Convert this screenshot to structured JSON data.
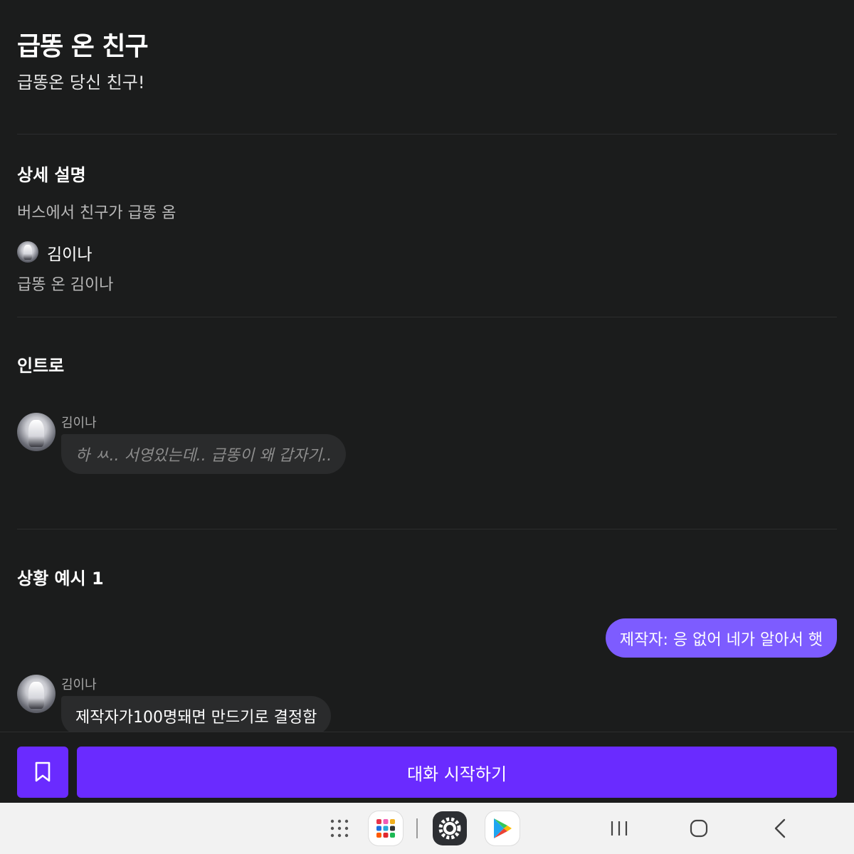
{
  "header": {
    "title": "급똥 온 친구",
    "subtitle": "급똥온 당신 친구!"
  },
  "detail": {
    "heading": "상세 설명",
    "description": "버스에서 친구가 급똥 옴",
    "creator_name": "김이나",
    "creator_line": "급똥 온 김이나"
  },
  "intro": {
    "heading": "인트로",
    "speaker": "김이나",
    "message": "하 ㅆ.. 서영있는데.. 급똥이 왜 갑자기.."
  },
  "example": {
    "heading": "상황 예시 1",
    "user_message": "제작자: 응 없어 네가 알아서 햇",
    "speaker": "김이나",
    "reply": "제작자가100명돼면 만드기로 결정함"
  },
  "actions": {
    "bookmark_icon": "bookmark-icon",
    "start_label": "대화 시작하기"
  },
  "navbar": {
    "icons": [
      "app-drawer-icon",
      "app-folder-icon",
      "settings-icon",
      "play-store-icon",
      "recents-icon",
      "home-icon",
      "back-icon"
    ]
  },
  "colors": {
    "background": "#1b1c1c",
    "accent": "#6a2bff",
    "user_bubble": "#7d5cff",
    "bot_bubble": "#2a2b2c"
  }
}
